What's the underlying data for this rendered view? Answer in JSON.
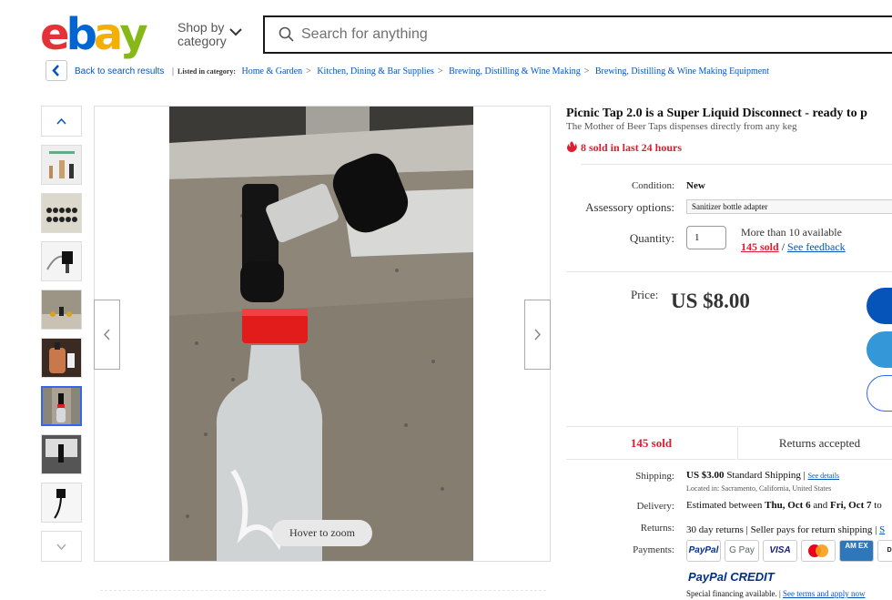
{
  "header": {
    "logo": "ebay",
    "shop_by_line1": "Shop by",
    "shop_by_line2": "category",
    "search_placeholder": "Search for anything"
  },
  "breadcrumb": {
    "back_label": "Back to search results",
    "listed_label": "Listed in category:",
    "items": [
      "Home & Garden",
      "Kitchen, Dining & Bar Supplies",
      "Brewing, Distilling & Wine Making",
      "Brewing, Distilling & Wine Making Equipment"
    ]
  },
  "gallery": {
    "hover_label": "Hover to zoom",
    "thumb_count": 8,
    "active_thumb_index": 5
  },
  "listing": {
    "title": "Picnic Tap 2.0 is a Super Liquid Disconnect - ready to p",
    "subtitle": "The Mother of Beer Taps dispenses directly from any keg",
    "sold_recent": "8 sold in last 24 hours",
    "condition_label": "Condition:",
    "condition_value": "New",
    "options_label": "Assessory options:",
    "options_value": "Sanitizer bottle adapter",
    "quantity_label": "Quantity:",
    "quantity_value": "1",
    "available": "More than 10 available",
    "sold_count": "145 sold",
    "see_feedback": "See feedback",
    "price_label": "Price:",
    "price": "US $8.00",
    "sold_box": "145 sold",
    "returns_box": "Returns accepted"
  },
  "details": {
    "shipping_label": "Shipping:",
    "shipping_cost": "US $3.00",
    "shipping_method": "Standard Shipping",
    "see_details": "See details",
    "located": "Located in: Sacramento, California, United States",
    "delivery_label": "Delivery:",
    "delivery_prefix": "Estimated between",
    "delivery_from": "Thu, Oct 6",
    "delivery_and": "and",
    "delivery_to": "Fri, Oct 7",
    "delivery_suffix": "to",
    "returns_label": "Returns:",
    "returns_text": "30 day returns | Seller pays for return shipping |",
    "returns_more": "S",
    "payments_label": "Payments:",
    "payment_methods": [
      "PayPal",
      "G Pay",
      "VISA",
      "Mastercard",
      "AM EX",
      "DISC"
    ],
    "paypal_credit": "PayPal CREDIT",
    "special_financing": "Special financing available.",
    "see_terms": "See terms and apply now"
  },
  "colors": {
    "ebay_e": "#e53238",
    "ebay_b": "#0064d2",
    "ebay_a": "#f5af02",
    "ebay_y": "#86b817",
    "link": "#0654ba",
    "accent_red": "#dd1e31",
    "cta_primary": "#0654ba",
    "cta_secondary": "#3498d8"
  }
}
